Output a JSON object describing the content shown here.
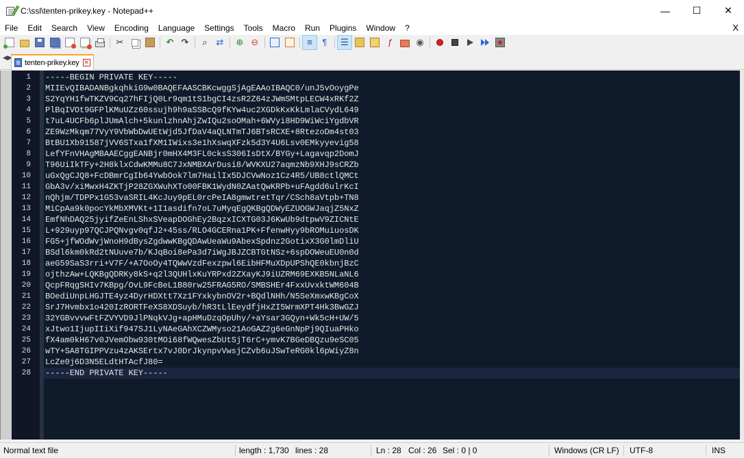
{
  "window": {
    "title": "C:\\ssl\\tenten-prikey.key - Notepad++",
    "minimize": "—",
    "maximize": "☐",
    "close": "✕"
  },
  "menu": {
    "items": [
      "File",
      "Edit",
      "Search",
      "View",
      "Encoding",
      "Language",
      "Settings",
      "Tools",
      "Macro",
      "Run",
      "Plugins",
      "Window",
      "?"
    ],
    "close_doc": "X"
  },
  "toolbar": {
    "icons": [
      "new-file-icon",
      "open-file-icon",
      "save-icon",
      "save-all-icon",
      "close-icon",
      "close-all-icon",
      "print-icon",
      "cut-icon",
      "copy-icon",
      "paste-icon",
      "undo-icon",
      "redo-icon",
      "find-icon",
      "replace-icon",
      "zoom-in-icon",
      "zoom-out-icon",
      "sync-vertical-icon",
      "sync-horizontal-icon",
      "word-wrap-icon",
      "show-all-chars-icon",
      "indent-guide-icon",
      "doc-map-icon",
      "function-list-icon",
      "folder-workspace-icon",
      "monitoring-icon",
      "record-macro-icon",
      "stop-record-icon",
      "playback-icon",
      "run-multiple-icon",
      "save-macro-icon"
    ]
  },
  "tab": {
    "label": "tenten-prikey.key",
    "close": "✕"
  },
  "editor": {
    "lines": [
      {
        "num": "1",
        "text": "-----BEGIN PRIVATE KEY-----"
      },
      {
        "num": "2",
        "text": "MIIEvQIBADANBgkqhkiG9w0BAQEFAASCBKcwggSjAgEAAoIBAQC0/unJ5vOoygPe"
      },
      {
        "num": "3",
        "text": "S2YqYH1fwTKZV9Cq27hFIjQ0Lr9qm1tS1bgCI4zsR2Z64zJWmSMtpLECW4xRKf2Z"
      },
      {
        "num": "4",
        "text": "PlBqIVOt9GFPlKMuUZz60ssujh9h9aSSBcQ9fKYw4uc2XGDkKxKkLmlaCVydL649"
      },
      {
        "num": "5",
        "text": "t7uL4UCFb6plJUmAlch+5kunlzhnAhjZwIQu2soOMah+6WVyi8HD9WiWciYgdbVR"
      },
      {
        "num": "6",
        "text": "ZE9WzMkqm77VyY9VbWbDwUEtWjd5JfDaV4aQLNTmTJ6BTsRCXE+8RtezoDm4st03"
      },
      {
        "num": "7",
        "text": "BtBU1Xb91587jVV6STxa1fXM1IWixs3e1hXswqXFzk5d3Y4U6Lsv0EMkyyevig58"
      },
      {
        "num": "8",
        "text": "LefYFnVHAgMBAAECggEANBjr0mHX4M3FL0cksS306IsDtX/BYGy+Lagavqp2DomJ"
      },
      {
        "num": "9",
        "text": "T96UiIkTFy+2H8klxCdwKMMu8C7JxNMBXArDusi8/WVKXU27aqmzNb9XHJ9sCRZb"
      },
      {
        "num": "10",
        "text": "uGxQgCJQ8+FcDBmrCgIb64YwbOok7lm7HailIx5DJCVwNoz1Cz4R5/UB8ctlQMCt"
      },
      {
        "num": "11",
        "text": "GbA3v/xiMwxH4ZKTjP28ZGXWuhXTo00FBK1WydN0ZAatQwKRPb+uFAgdd6ulrKcI"
      },
      {
        "num": "12",
        "text": "nQhjm/TDPPx1G53vaSRIL4KcJuy9pEL0rcPeIA8gmwtretTqr/CSch8aVtpb+TN8"
      },
      {
        "num": "13",
        "text": "MiCpAa9k0pocYkMbXMVKt+1I1asdifn7oL7uMyqEgQKBgQDWyEZUOGWJaqjZ5NxZ"
      },
      {
        "num": "14",
        "text": "EmfNhDAQ25jyifZeEnLShxSVeapDOGhEy2BqzxICXTG03J6KwUb9dtpwV9ZICNtE"
      },
      {
        "num": "15",
        "text": "L+929uyp97QCJPQNvgv0qfJ2+45ss/RLO4GCERna1PK+FfenwHyy9bROMuiuosDK"
      },
      {
        "num": "16",
        "text": "FG5+jfWOdWvjWnoH9dBysZgdwwKBgQDAwUeaWu9AbexSpdnz2GotixX3G0lmDliU"
      },
      {
        "num": "17",
        "text": "BSdl6km0kRd2tNUuve7b/KJqBoi8ePa3d7iWgJBJZCBTGtNSz+6spDOWeuEU0n0d"
      },
      {
        "num": "18",
        "text": "aeG59SaS3rri+V7F/+A7OoOy4TQWwVzdFexzpwl6EibHFMuXDpUPShQE0kbnjBzC"
      },
      {
        "num": "19",
        "text": "ojthzAw+LQKBgQDRKy8kS+q2l3QUHlxKuYRPxd2ZXayKJ9iUZRM69EXKB5NLaNL6"
      },
      {
        "num": "20",
        "text": "QcpFRqgSHIv7KBpg/OvL9FcBeL1B80rw25FRAG5RO/SMBSHEr4FxxUvxktWM604B"
      },
      {
        "num": "21",
        "text": "BOediUnpLHGJTE4yz4DyrHDXtt7Xz1FYxkybnOV2r+BQdlNHh/N5SeXmxwKBgCoX"
      },
      {
        "num": "22",
        "text": "SrJ7Hvmbx1o420IzRORTFeXS8XDSuyb/hR3tLlEeydfjHxZI5WrmXPT4Hk3BwGZJ"
      },
      {
        "num": "23",
        "text": "32YGBvvvwFtFZVYVD9JlPNqkVJg+apHMuDzqOpUhy/+aYsar3GQyn+Wk5cH+UW/5"
      },
      {
        "num": "24",
        "text": "xJtwo1IjupIIiXif947SJ1LyNAeGAhXCZWMyso21AoGAZ2g6eGnNpPj9QIuaPHko"
      },
      {
        "num": "25",
        "text": "fX4am0kH67v0JVemObw930tMOi68fWQwesZbUtSjT6rC+ymvK7BGeDBQzu9eSC05"
      },
      {
        "num": "26",
        "text": "wTY+SA8TGIPPVzu4zAKSErtx7vJ0DrJkynpvVwsjCZvb6uJSwTeRG0kl6pWiyZ8n"
      },
      {
        "num": "27",
        "text": "LcZe0j6D3N5ELdtHTAcfJ80="
      },
      {
        "num": "28",
        "text": "-----END PRIVATE KEY-----"
      }
    ],
    "current_line": 28
  },
  "status": {
    "file_type": "Normal text file",
    "length": "length : 1,730",
    "lines": "lines : 28",
    "ln": "Ln : 28",
    "col": "Col : 26",
    "sel": "Sel : 0 | 0",
    "eol": "Windows (CR LF)",
    "encoding": "UTF-8",
    "mode": "INS"
  },
  "colors": {
    "editor_bg": "#0f1b2a",
    "gutter_bg": "#101626",
    "text": "#e6e6e6",
    "tab_accent": "#f5a623"
  }
}
